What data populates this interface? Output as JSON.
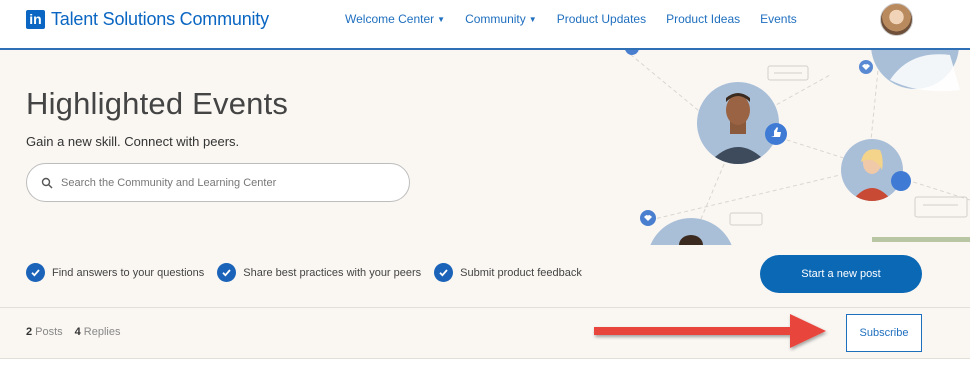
{
  "header": {
    "logo_mark": "in",
    "logo_text": "Talent Solutions Community",
    "nav": [
      {
        "label": "Welcome Center",
        "has_dropdown": true
      },
      {
        "label": "Community",
        "has_dropdown": true
      },
      {
        "label": "Product Updates",
        "has_dropdown": false
      },
      {
        "label": "Product Ideas",
        "has_dropdown": false
      },
      {
        "label": "Events",
        "has_dropdown": false
      }
    ]
  },
  "hero": {
    "title": "Highlighted Events",
    "subtitle": "Gain a new skill. Connect with peers.",
    "search_placeholder": "Search the Community and Learning Center",
    "checks": [
      "Find answers to your questions",
      "Share best practices with your peers",
      "Submit product feedback"
    ],
    "post_button": "Start a new post"
  },
  "stats": {
    "posts_count": "2",
    "posts_label": "Posts",
    "replies_count": "4",
    "replies_label": "Replies",
    "subscribe_label": "Subscribe"
  },
  "colors": {
    "brand_blue": "#0a66c2",
    "button_blue": "#0b68b5",
    "hero_bg": "#faf7f3",
    "arrow_red": "#e8453c"
  }
}
